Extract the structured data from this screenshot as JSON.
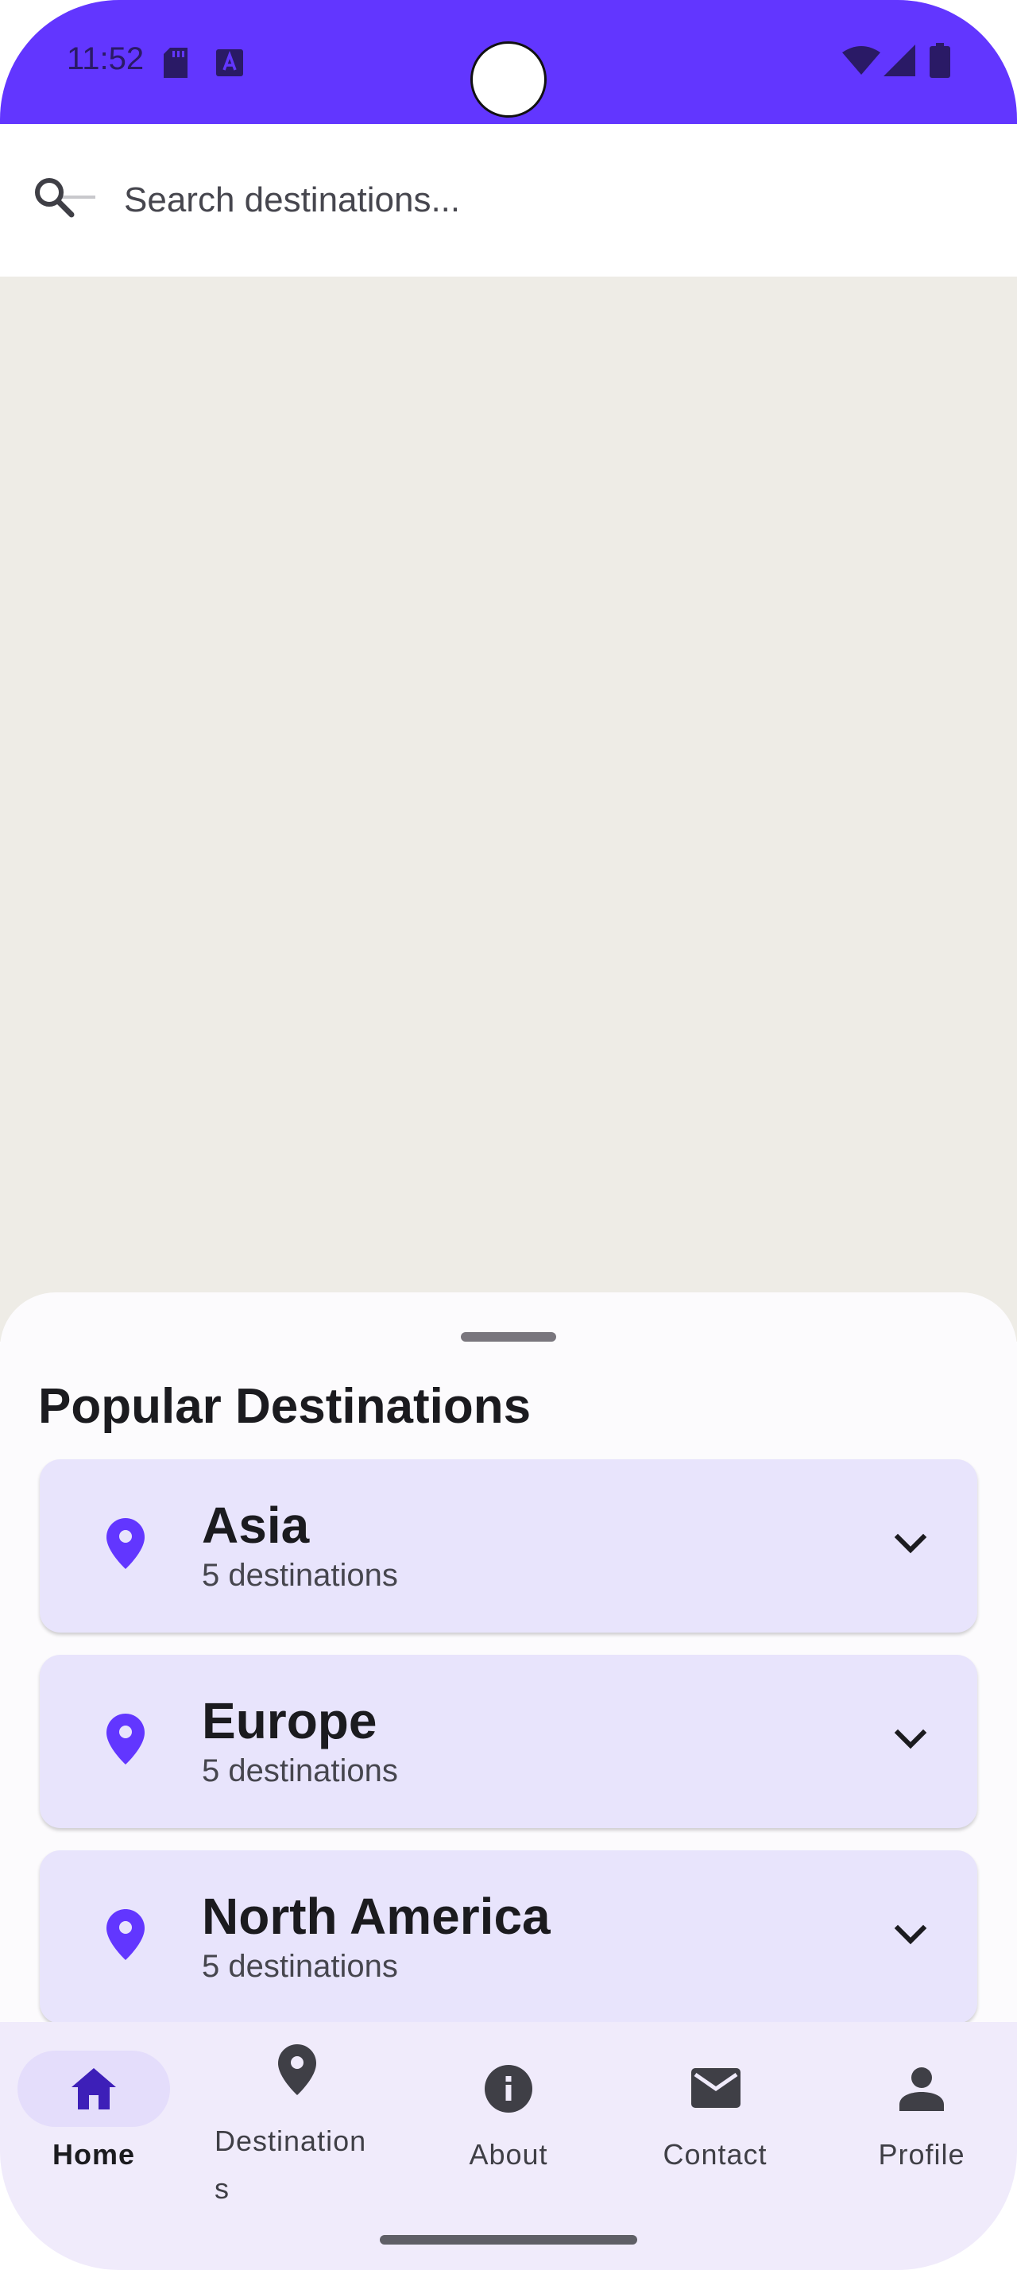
{
  "status_bar": {
    "time": "11:52",
    "left_icons": [
      "sd-card-icon",
      "keyboard-a-icon"
    ],
    "right_icons": [
      "wifi-icon",
      "signal-icon",
      "battery-icon"
    ],
    "color": "#6236FF"
  },
  "search": {
    "placeholder": "Search destinations...",
    "value": "",
    "icon": "search-icon"
  },
  "map": {
    "background": "#EEECE6"
  },
  "sheet": {
    "title": "Popular Destinations",
    "regions": [
      {
        "name": "Asia",
        "count": "5 destinations",
        "icon": "location-pin-icon",
        "expand_icon": "chevron-down-icon"
      },
      {
        "name": "Europe",
        "count": "5 destinations",
        "icon": "location-pin-icon",
        "expand_icon": "chevron-down-icon"
      },
      {
        "name": "North America",
        "count": "5 destinations",
        "icon": "location-pin-icon",
        "expand_icon": "chevron-down-icon"
      }
    ],
    "card_color": "#E8E4FC",
    "accent": "#6236FF"
  },
  "bottom_nav": {
    "items": [
      {
        "label": "Home",
        "icon": "home-icon",
        "active": true
      },
      {
        "label": "Destinations",
        "label_line1": "Destination",
        "label_line2": "s",
        "icon": "location-pin-icon",
        "active": false
      },
      {
        "label": "About",
        "icon": "info-icon",
        "active": false
      },
      {
        "label": "Contact",
        "icon": "mail-icon",
        "active": false
      },
      {
        "label": "Profile",
        "icon": "person-icon",
        "active": false
      }
    ]
  }
}
